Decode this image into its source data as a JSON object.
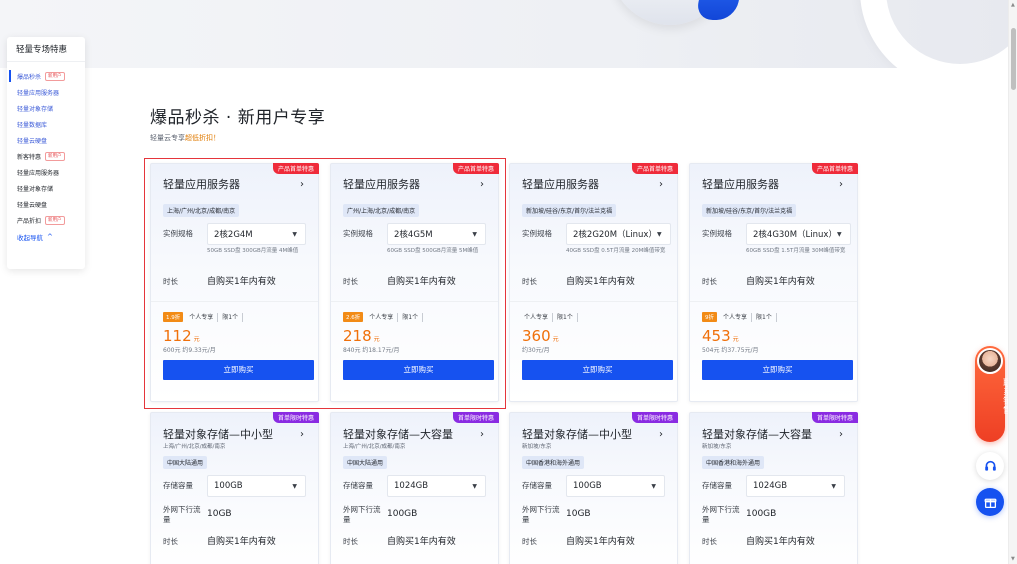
{
  "sidenav": {
    "title": "轻量专场特惠",
    "items": [
      {
        "label": "爆品秒杀",
        "tag": "新用户"
      },
      {
        "label": "轻量应用服务器"
      },
      {
        "label": "轻量对象存储"
      },
      {
        "label": "轻量数据库"
      },
      {
        "label": "轻量云硬盘"
      },
      {
        "label": "新客特惠",
        "tag": "新用户"
      },
      {
        "label": "轻量应用服务器"
      },
      {
        "label": "轻量对象存储"
      },
      {
        "label": "轻量云硬盘"
      },
      {
        "label": "产品折扣",
        "tag": "新用户"
      }
    ],
    "collapse": "收起导航",
    "collapse_icon": "chevron-up-icon"
  },
  "section": {
    "title": "爆品秒杀 · 新用户专享",
    "subtitle_prefix": "轻量云专享",
    "subtitle_highlight": "超低折扣！"
  },
  "labels": {
    "spec": "实例规格",
    "duration": "时长",
    "capacity": "存储容量",
    "traffic": "外网下行流量",
    "buy": "立即购买"
  },
  "server_cards": [
    {
      "ribbon": "产品首单特惠",
      "title": "轻量应用服务器",
      "region": "上海/广州/北京/成都/南京",
      "spec": "2核2G4M",
      "spec_desc": "50GB SSD盘 300GB月流量 4M峰值",
      "duration": "自购买1年内有效",
      "discount": "1.9折",
      "tags": [
        "个人专享",
        "限1个"
      ],
      "price": "112",
      "price_unit": "元",
      "orig": "600元 约9.33元/月"
    },
    {
      "ribbon": "产品首单特惠",
      "title": "轻量应用服务器",
      "region": "广州/上海/北京/成都/南京",
      "spec": "2核4G5M",
      "spec_desc": "60GB SSD盘 500GB月流量 5M峰值",
      "duration": "自购买1年内有效",
      "discount": "2.6折",
      "tags": [
        "个人专享",
        "限1个"
      ],
      "price": "218",
      "price_unit": "元",
      "orig": "840元 约18.17元/月"
    },
    {
      "ribbon": "产品首单特惠",
      "title": "轻量应用服务器",
      "region": "新加坡/硅谷/东京/首尔/法兰克福",
      "spec": "2核2G20M（Linux）",
      "spec_desc": "40GB SSD盘 0.5T月流量 20M峰值带宽",
      "duration": "自购买1年内有效",
      "discount": "",
      "tags": [
        "个人专享",
        "限1个"
      ],
      "price": "360",
      "price_unit": "元",
      "orig": "约30元/月"
    },
    {
      "ribbon": "产品首单特惠",
      "title": "轻量应用服务器",
      "region": "新加坡/硅谷/东京/首尔/法兰克福",
      "spec": "2核4G30M（Linux）",
      "spec_desc": "60GB SSD盘 1.5T月流量 30M峰值带宽",
      "duration": "自购买1年内有效",
      "discount": "9折",
      "tags": [
        "个人专享",
        "限1个"
      ],
      "price": "453",
      "price_unit": "元",
      "orig": "504元 约37.75元/月"
    }
  ],
  "storage_cards": [
    {
      "ribbon": "首单限时特惠",
      "title": "轻量对象存储—中小型",
      "subregion": "上海/广州/北京/成都/南京",
      "region": "中国大陆通用",
      "capacity": "100GB",
      "traffic": "10GB",
      "duration": "自购买1年内有效"
    },
    {
      "ribbon": "首单限时特惠",
      "title": "轻量对象存储—大容量",
      "subregion": "上海/广州/北京/成都/南京",
      "region": "中国大陆通用",
      "capacity": "1024GB",
      "traffic": "100GB",
      "duration": "自购买1年内有效"
    },
    {
      "ribbon": "首单限时特惠",
      "title": "轻量对象存储—中小型",
      "subregion": "新加坡/东京",
      "region": "中国香港和海外通用",
      "capacity": "100GB",
      "traffic": "10GB",
      "duration": "自购买1年内有效"
    },
    {
      "ribbon": "首单限时特惠",
      "title": "轻量对象存储—大容量",
      "subregion": "新加坡/东京",
      "region": "中国香港和海外通用",
      "capacity": "1024GB",
      "traffic": "100GB",
      "duration": "自购买1年内有效"
    }
  ],
  "float": {
    "sales": "联系销售",
    "service_icon": "headset-icon",
    "gift_icon": "gift-icon"
  },
  "colors": {
    "accent": "#1652f0",
    "price": "#f0700a",
    "ribbon_red": "#ef2b3a",
    "ribbon_purple": "#8a2be2",
    "highlight_border": "#e5353b"
  }
}
